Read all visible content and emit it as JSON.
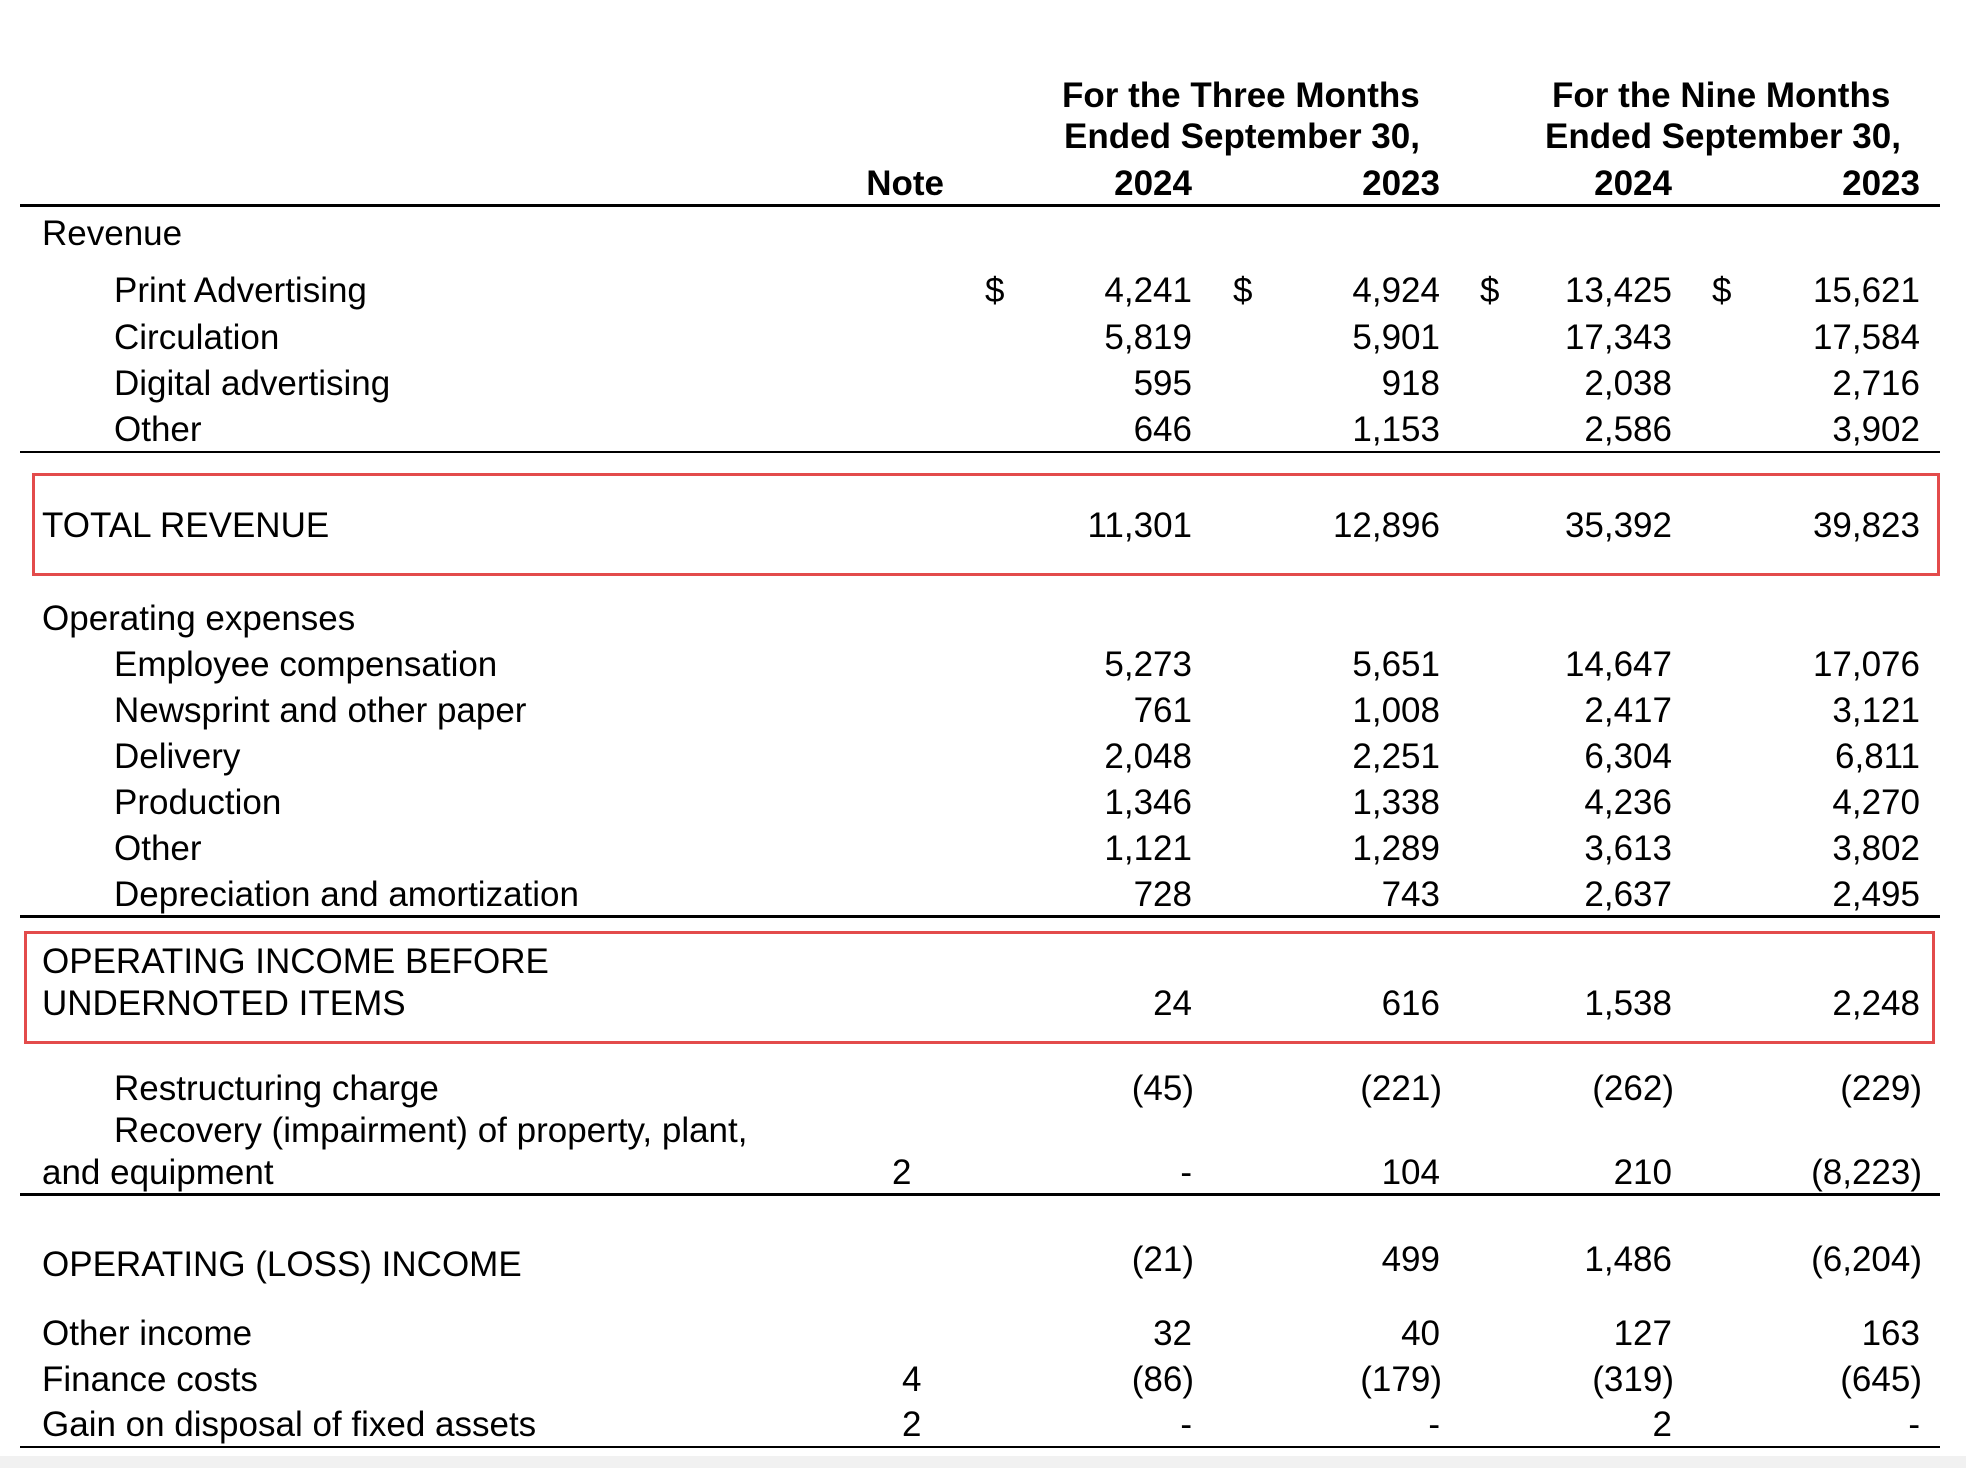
{
  "header": {
    "three_months_l1": "For the Three Months",
    "three_months_l2": "Ended September 30,",
    "nine_months_l1": "For the Nine Months",
    "nine_months_l2": "Ended September 30,",
    "note": "Note",
    "years": [
      "2024",
      "2023",
      "2024",
      "2023"
    ]
  },
  "currency": "$",
  "revenue": {
    "label": "Revenue",
    "items": [
      {
        "label": "Print Advertising",
        "values": [
          "4,241",
          "4,924",
          "13,425",
          "15,621"
        ]
      },
      {
        "label": "Circulation",
        "values": [
          "5,819",
          "5,901",
          "17,343",
          "17,584"
        ]
      },
      {
        "label": "Digital advertising",
        "values": [
          "595",
          "918",
          "2,038",
          "2,716"
        ]
      },
      {
        "label": "Other",
        "values": [
          "646",
          "1,153",
          "2,586",
          "3,902"
        ]
      }
    ]
  },
  "total_revenue": {
    "label": "TOTAL REVENUE",
    "values": [
      "11,301",
      "12,896",
      "35,392",
      "39,823"
    ]
  },
  "operating_expenses": {
    "label": "Operating expenses",
    "items": [
      {
        "label": "Employee compensation",
        "values": [
          "5,273",
          "5,651",
          "14,647",
          "17,076"
        ]
      },
      {
        "label": "Newsprint and other paper",
        "values": [
          "761",
          "1,008",
          "2,417",
          "3,121"
        ]
      },
      {
        "label": "Delivery",
        "values": [
          "2,048",
          "2,251",
          "6,304",
          "6,811"
        ]
      },
      {
        "label": "Production",
        "values": [
          "1,346",
          "1,338",
          "4,236",
          "4,270"
        ]
      },
      {
        "label": "Other",
        "values": [
          "1,121",
          "1,289",
          "3,613",
          "3,802"
        ]
      },
      {
        "label": "Depreciation and amortization",
        "values": [
          "728",
          "743",
          "2,637",
          "2,495"
        ]
      }
    ]
  },
  "operating_income_before": {
    "label_l1": "OPERATING INCOME BEFORE",
    "label_l2": "UNDERNOTED ITEMS",
    "values": [
      "24",
      "616",
      "1,538",
      "2,248"
    ]
  },
  "restructuring": {
    "label": "Restructuring charge",
    "values": [
      "(45)",
      "(221)",
      "(262)",
      "(229)"
    ]
  },
  "recovery": {
    "label_l1": "Recovery (impairment) of property, plant,",
    "label_l2": "and equipment",
    "note": "2",
    "values": [
      "-",
      "104",
      "210",
      "(8,223)"
    ]
  },
  "operating_loss_income": {
    "label": "OPERATING (LOSS) INCOME",
    "values": [
      "(21)",
      "499",
      "1,486",
      "(6,204)"
    ]
  },
  "other_income": {
    "label": "Other income",
    "values": [
      "32",
      "40",
      "127",
      "163"
    ]
  },
  "finance_costs": {
    "label": "Finance costs",
    "note": "4",
    "values": [
      "(86)",
      "(179)",
      "(319)",
      "(645)"
    ]
  },
  "gain_disposal": {
    "label": "Gain on disposal of fixed assets",
    "note": "2",
    "values": [
      "-",
      "-",
      "2",
      "-"
    ]
  },
  "colors": {
    "highlight_border": "#e34b4b",
    "text": "#000000"
  }
}
